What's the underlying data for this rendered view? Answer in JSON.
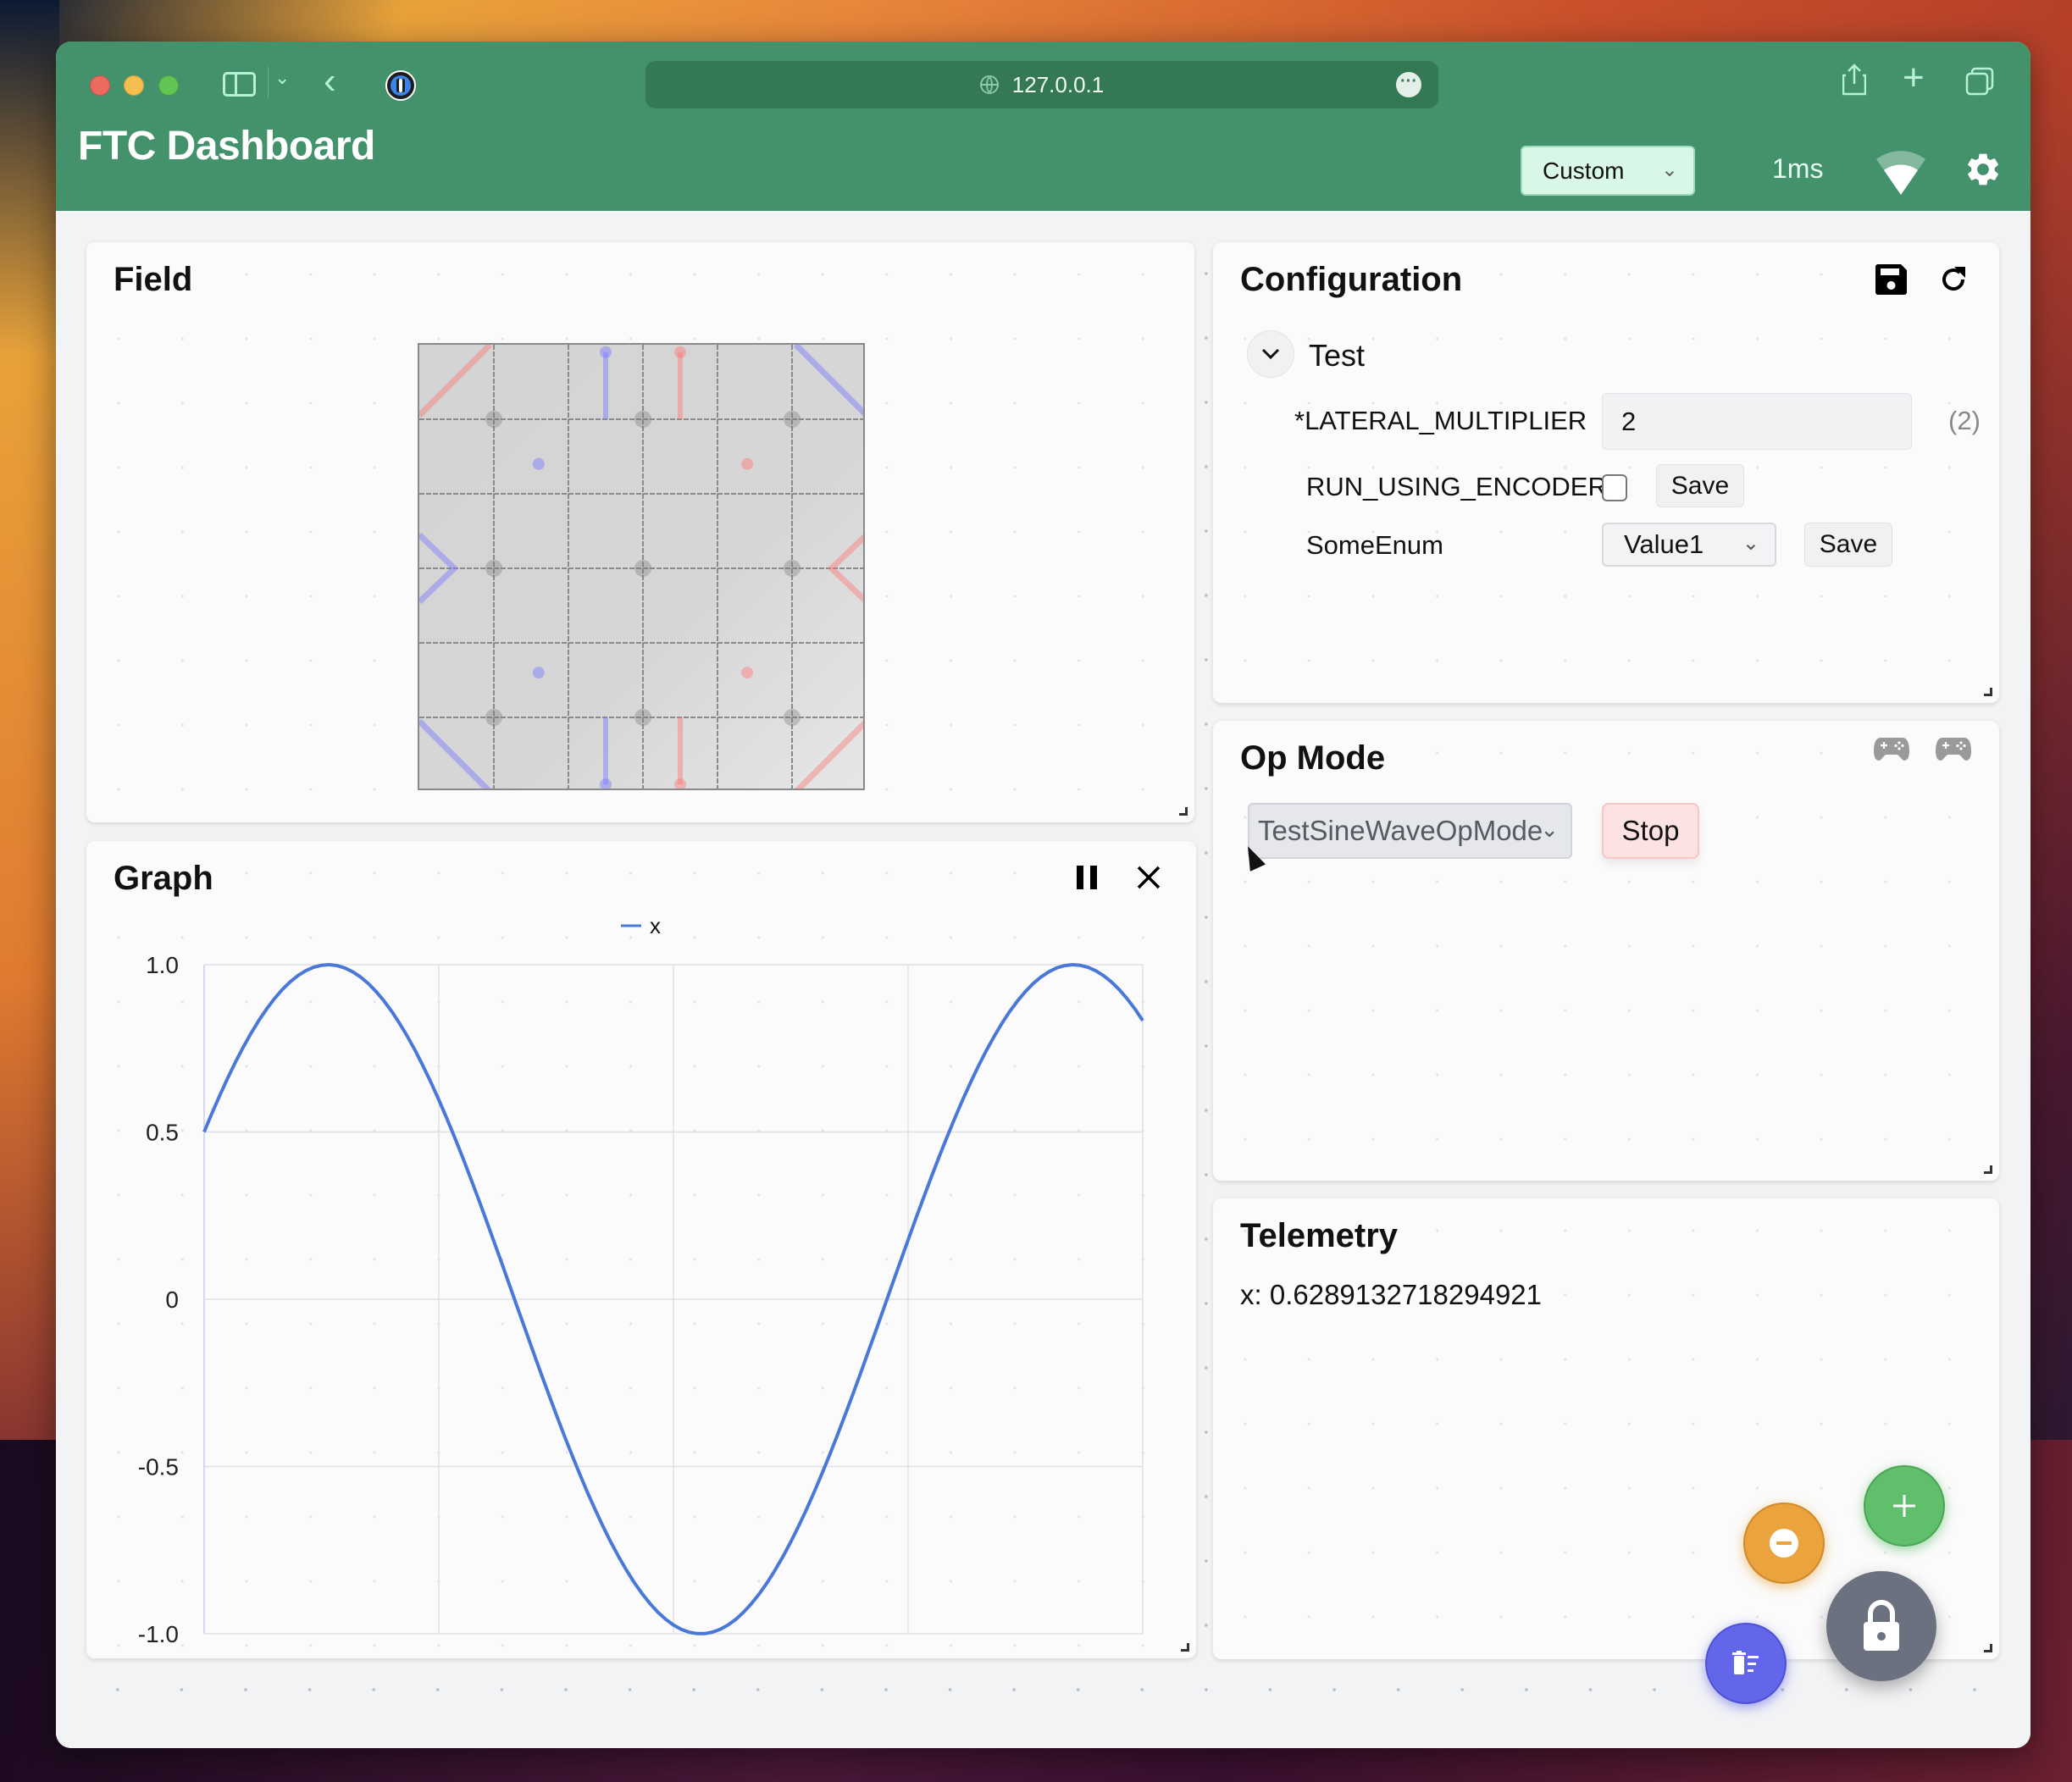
{
  "browser": {
    "url": "127.0.0.1",
    "icons": [
      "sidebar-icon",
      "chevron-down-icon",
      "back-icon",
      "password-manager-icon",
      "globe-icon",
      "more-icon",
      "share-icon",
      "plus-icon",
      "tabs-icon"
    ]
  },
  "header": {
    "title": "FTC Dashboard",
    "layout_select": "Custom",
    "latency": "1ms",
    "colors": {
      "bar": "#43926c",
      "select_bg": "#d8f7e6"
    }
  },
  "field": {
    "title": "Field"
  },
  "graph": {
    "title": "Graph",
    "pause_icon": "pause-icon",
    "close_icon": "close-icon"
  },
  "configuration": {
    "title": "Configuration",
    "group": "Test",
    "rows": [
      {
        "label": "*LATERAL_MULTIPLIER",
        "value": "2",
        "hint": "(2)"
      },
      {
        "label": "RUN_USING_ENCODER",
        "checked": false,
        "save": "Save"
      },
      {
        "label": "SomeEnum",
        "value": "Value1",
        "save": "Save"
      }
    ]
  },
  "opmode": {
    "title": "Op Mode",
    "selected": "TestSineWaveOpMode",
    "stop_label": "Stop"
  },
  "telemetry": {
    "title": "Telemetry",
    "lines": [
      "x: 0.6289132718294921"
    ]
  },
  "fabs": {
    "add": "+",
    "remove": "−",
    "clear_icon": "clear-layout-icon",
    "lock_icon": "lock-icon"
  },
  "chart_data": {
    "type": "line",
    "title": "",
    "xlabel": "",
    "ylabel": "",
    "legend": [
      "x"
    ],
    "legend_position": "top-center",
    "ylim": [
      -1.0,
      1.0
    ],
    "yticks": [
      "1.0",
      "0.5",
      "0",
      "-0.5",
      "-1.0"
    ],
    "ytick_values": [
      1.0,
      0.5,
      0,
      -0.5,
      -1.0
    ],
    "x_grid_divisions": 4,
    "grid": true,
    "series": [
      {
        "name": "x",
        "color": "#4a78d8",
        "function": "sine",
        "amplitude": 1.0,
        "start_value": 0.5,
        "periods_shown": 1.26,
        "end_value": 0.84
      }
    ]
  }
}
